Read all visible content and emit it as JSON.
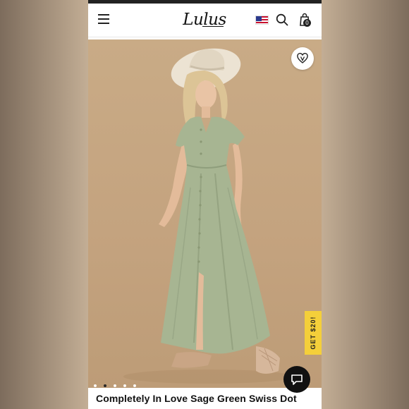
{
  "header": {
    "logo_text": "Lulus",
    "cart_count": "0",
    "icons": [
      "menu-icon",
      "us-flag-icon",
      "search-icon",
      "shopping-bag-icon"
    ]
  },
  "hero": {
    "favorite_icon": "heart-v-icon",
    "promo_tab_label": "GET $20!",
    "carousel": {
      "total": 5,
      "active_index": 1
    },
    "chat_icon": "chat-bubble-icon"
  },
  "product": {
    "title": "Completely In Love Sage Green Swiss Dot"
  },
  "colors": {
    "background_tan": "#c7a883",
    "dress_sage": "#a7b592",
    "promo_yellow": "#f4cf3a",
    "chat_black": "#111111"
  }
}
